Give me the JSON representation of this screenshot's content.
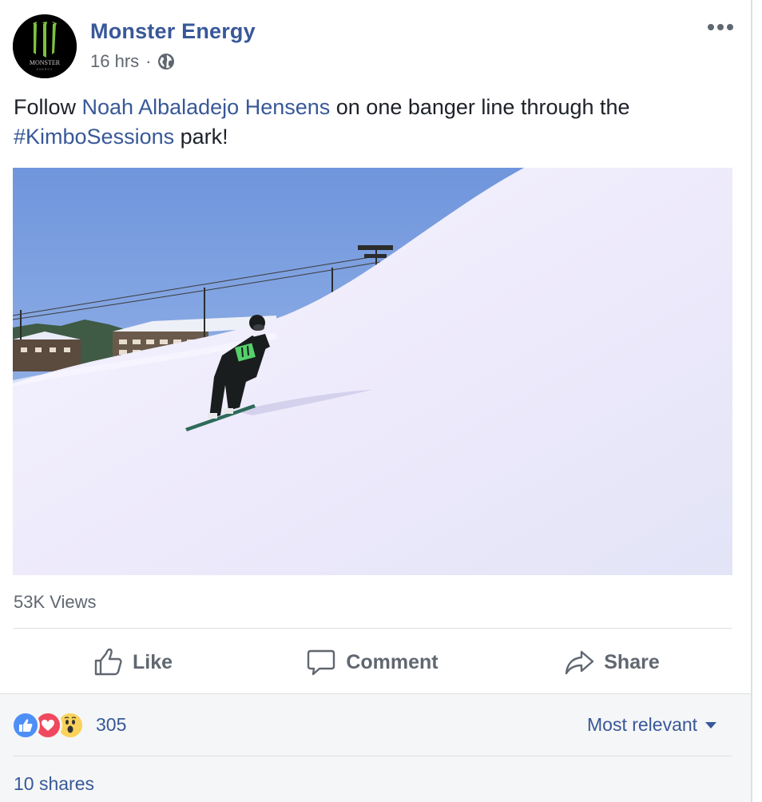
{
  "post": {
    "author": "Monster Energy",
    "time": "16 hrs",
    "separator": "·",
    "privacy_icon": "globe-icon",
    "text_prefix": "Follow ",
    "mention": "Noah Albaladejo Hensens",
    "text_middle": " on one banger line through the ",
    "hashtag": "#KimboSessions",
    "text_suffix": " park!",
    "logo_text": "MONSTER",
    "logo_subtext": "ENERGY"
  },
  "video": {
    "views": "53K Views",
    "mute_icon": "muted-speaker-icon"
  },
  "actions": {
    "like": "Like",
    "comment": "Comment",
    "share": "Share"
  },
  "footer": {
    "reaction_count": "305",
    "reactions": [
      "like",
      "love",
      "wow"
    ],
    "sort_label": "Most relevant",
    "shares": "10 shares"
  },
  "colors": {
    "link": "#385898",
    "secondary_text": "#606770",
    "divider": "#dddfe2",
    "footer_bg": "#f5f6f7",
    "monster_green": "#7cc242"
  }
}
